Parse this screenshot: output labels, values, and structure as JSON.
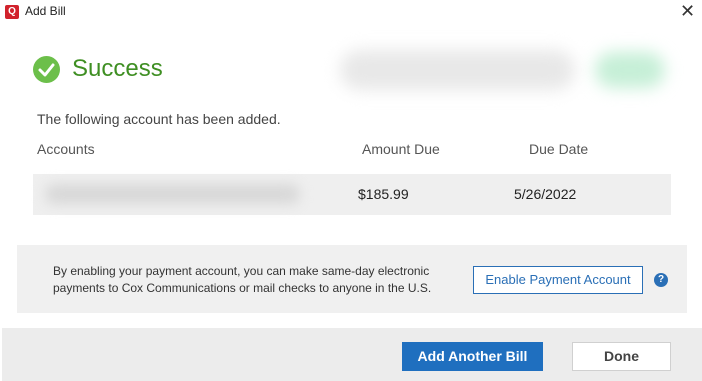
{
  "window": {
    "app_icon_glyph": "Q",
    "title": "Add Bill",
    "close_glyph": "✕"
  },
  "status": {
    "icon": "check-circle-icon",
    "text": "Success",
    "color": "#3f8f23"
  },
  "message": "The following account has been added.",
  "table": {
    "headers": [
      "Accounts",
      "Amount Due",
      "Due Date"
    ],
    "rows": [
      {
        "account": "",
        "amount_due": "$185.99",
        "due_date": "5/26/2022"
      }
    ]
  },
  "info": {
    "line1": "By enabling your payment account, you can make same-day electronic",
    "line2": "payments to Cox Communications or mail checks to anyone in the U.S.",
    "enable_button": "Enable Payment Account",
    "help_glyph": "?"
  },
  "footer": {
    "add_button": "Add Another Bill",
    "done_button": "Done"
  },
  "colors": {
    "accent": "#1f6fbf",
    "success": "#6cbf4a"
  }
}
